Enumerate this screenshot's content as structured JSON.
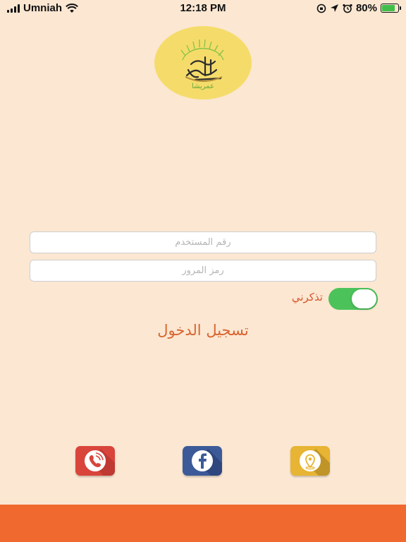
{
  "status_bar": {
    "carrier": "Umniah",
    "time": "12:18 PM",
    "battery_percent": "80%",
    "battery_level": 0.8,
    "icons": [
      "signal-icon",
      "wifi-icon",
      "screen-lock-icon",
      "location-arrow-icon",
      "alarm-icon",
      "battery-icon"
    ]
  },
  "logo": {
    "caption": "عمريشا"
  },
  "form": {
    "username_placeholder": "رقم المستخدم",
    "password_placeholder": "رمز المرور",
    "remember_label": "تذكرني",
    "remember_on": true,
    "login_label": "تسجيل الدخول"
  },
  "social": [
    {
      "name": "phone",
      "icon": "phone-icon",
      "color": "#d9453b"
    },
    {
      "name": "facebook",
      "icon": "facebook-icon",
      "color": "#3c5a98"
    },
    {
      "name": "location",
      "icon": "location-pin-icon",
      "color": "#e7b433"
    }
  ],
  "colors": {
    "background": "#fbe7d2",
    "accent": "#f0692e",
    "login_text": "#d9642f",
    "toggle_on": "#4cc35a",
    "logo_circle": "#f5dc6a"
  }
}
